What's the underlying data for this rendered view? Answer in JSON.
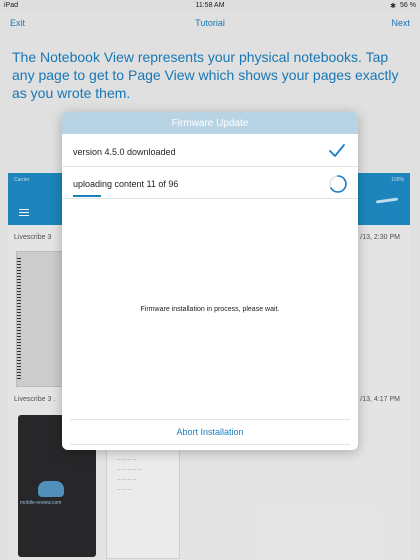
{
  "status_bar": {
    "device": "iPad",
    "time": "11:58 AM",
    "battery": "56 %"
  },
  "nav": {
    "left": "Exit",
    "title": "Tutorial",
    "right": "Next"
  },
  "intro": {
    "text": "The Notebook View represents your physical notebooks. Tap any page to get to Page View which shows your pages exactly as you wrote them."
  },
  "preview": {
    "carrier": "Carrier",
    "battery": "100%",
    "notebooks": [
      {
        "label": "Livescribe 3",
        "date": "/13, 2:30 PM"
      },
      {
        "label": "Livescribe 3 .",
        "date": "/13, 4:17 PM"
      }
    ],
    "watermark": "mobile-review.com"
  },
  "modal": {
    "title": "Firmware Update",
    "step1": "version 4.5.0 downloaded",
    "step2": "uploading content 11 of 96",
    "message": "Firmware installation in process, please wait.",
    "abort": "Abort Installation"
  },
  "colors": {
    "accent": "#1a7fc1",
    "header": "#b8d4e4",
    "app_bar": "#1f8ec7"
  },
  "icons": {
    "step1": "checkmark-icon",
    "step2": "spinner-icon"
  }
}
